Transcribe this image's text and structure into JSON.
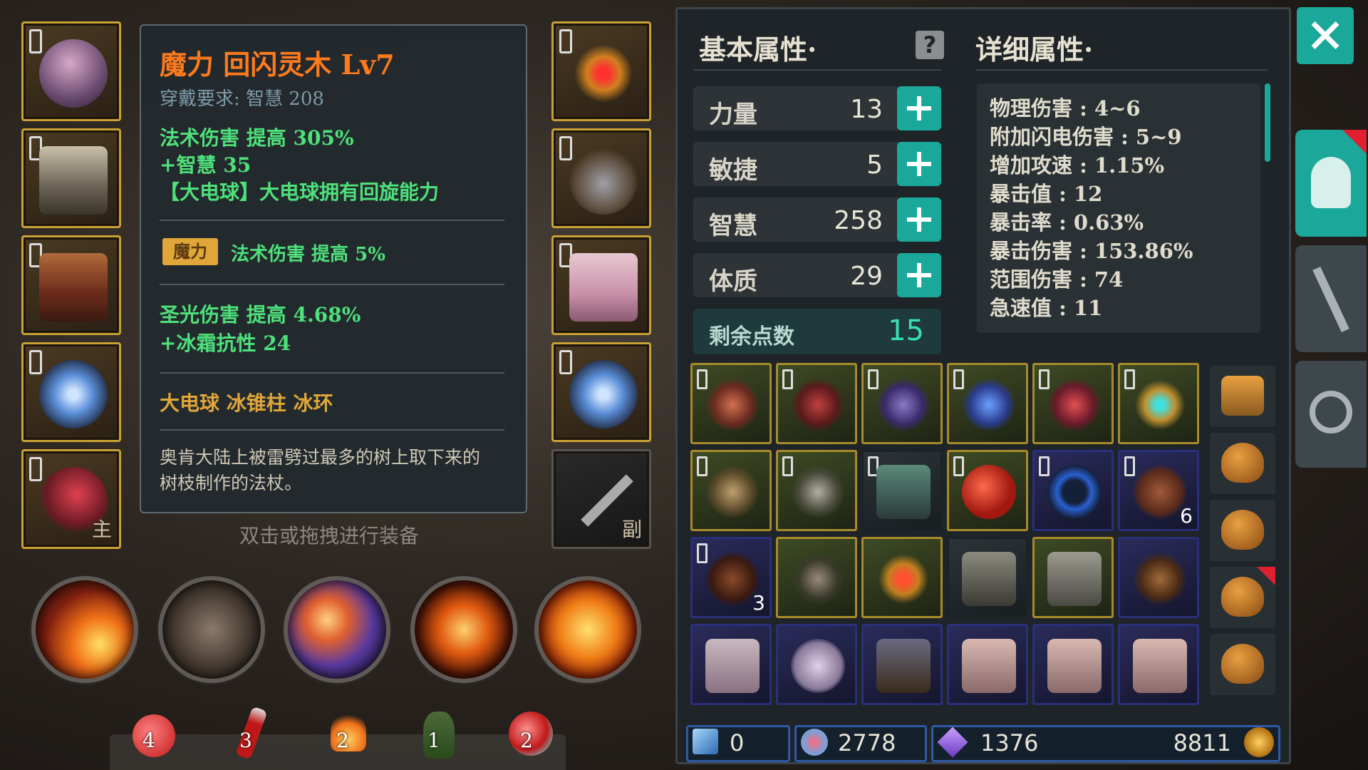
{
  "equipment_left": [
    {
      "name": "helmet"
    },
    {
      "name": "armor"
    },
    {
      "name": "belt"
    },
    {
      "name": "ring"
    },
    {
      "name": "staff",
      "corner": "主"
    }
  ],
  "equipment_right": [
    {
      "name": "amulet"
    },
    {
      "name": "gloves"
    },
    {
      "name": "boots"
    },
    {
      "name": "ring"
    },
    {
      "name": "offhand",
      "corner": "副"
    }
  ],
  "tooltip": {
    "title": "魔力 回闪灵木 Lv7",
    "requirement": "穿戴要求:   智慧 208",
    "attr1": "法术伤害 提高 305%",
    "attr2": "+智慧 35",
    "attr3": "【大电球】大电球拥有回旋能力",
    "badge": "魔力",
    "badge_text": "法术伤害 提高 5%",
    "attr4": "圣光伤害 提高 4.68%",
    "attr5": "+冰霜抗性 24",
    "skills_line": "大电球   冰锥柱   冰环",
    "desc1": "奥肯大陆上被雷劈过最多的树上取下来的",
    "desc2": "树枝制作的法杖。",
    "hint": "双击或拖拽进行装备"
  },
  "potions": [
    "4",
    "3",
    "2",
    "1",
    "2"
  ],
  "panel": {
    "basic_title": "基本属性·",
    "detail_title": "详细属性·",
    "stats": [
      {
        "label": "力量",
        "value": "13"
      },
      {
        "label": "敏捷",
        "value": "5"
      },
      {
        "label": "智慧",
        "value": "258"
      },
      {
        "label": "体质",
        "value": "29"
      }
    ],
    "remaining_label": "剩余点数",
    "remaining_value": "15",
    "details": [
      "物理伤害 : 4~6",
      "附加闪电伤害 : 5~9",
      "增加攻速 : 1.15%",
      "暴击值 : 12",
      "暴击率 : 0.63%",
      "暴击伤害 : 153.86%",
      "范围伤害 : 74",
      "急速值 : 11"
    ],
    "inventory_counts": {
      "r1c5": "6",
      "r2c0": "3"
    },
    "currency": {
      "gem": "0",
      "crystal": "2778",
      "soul": "1376",
      "gold": "8811"
    }
  },
  "colors": {
    "accent": "#19a89a",
    "title_orange": "#ff7a1c",
    "green_text": "#4ee07a",
    "gold": "#e0a63a"
  }
}
